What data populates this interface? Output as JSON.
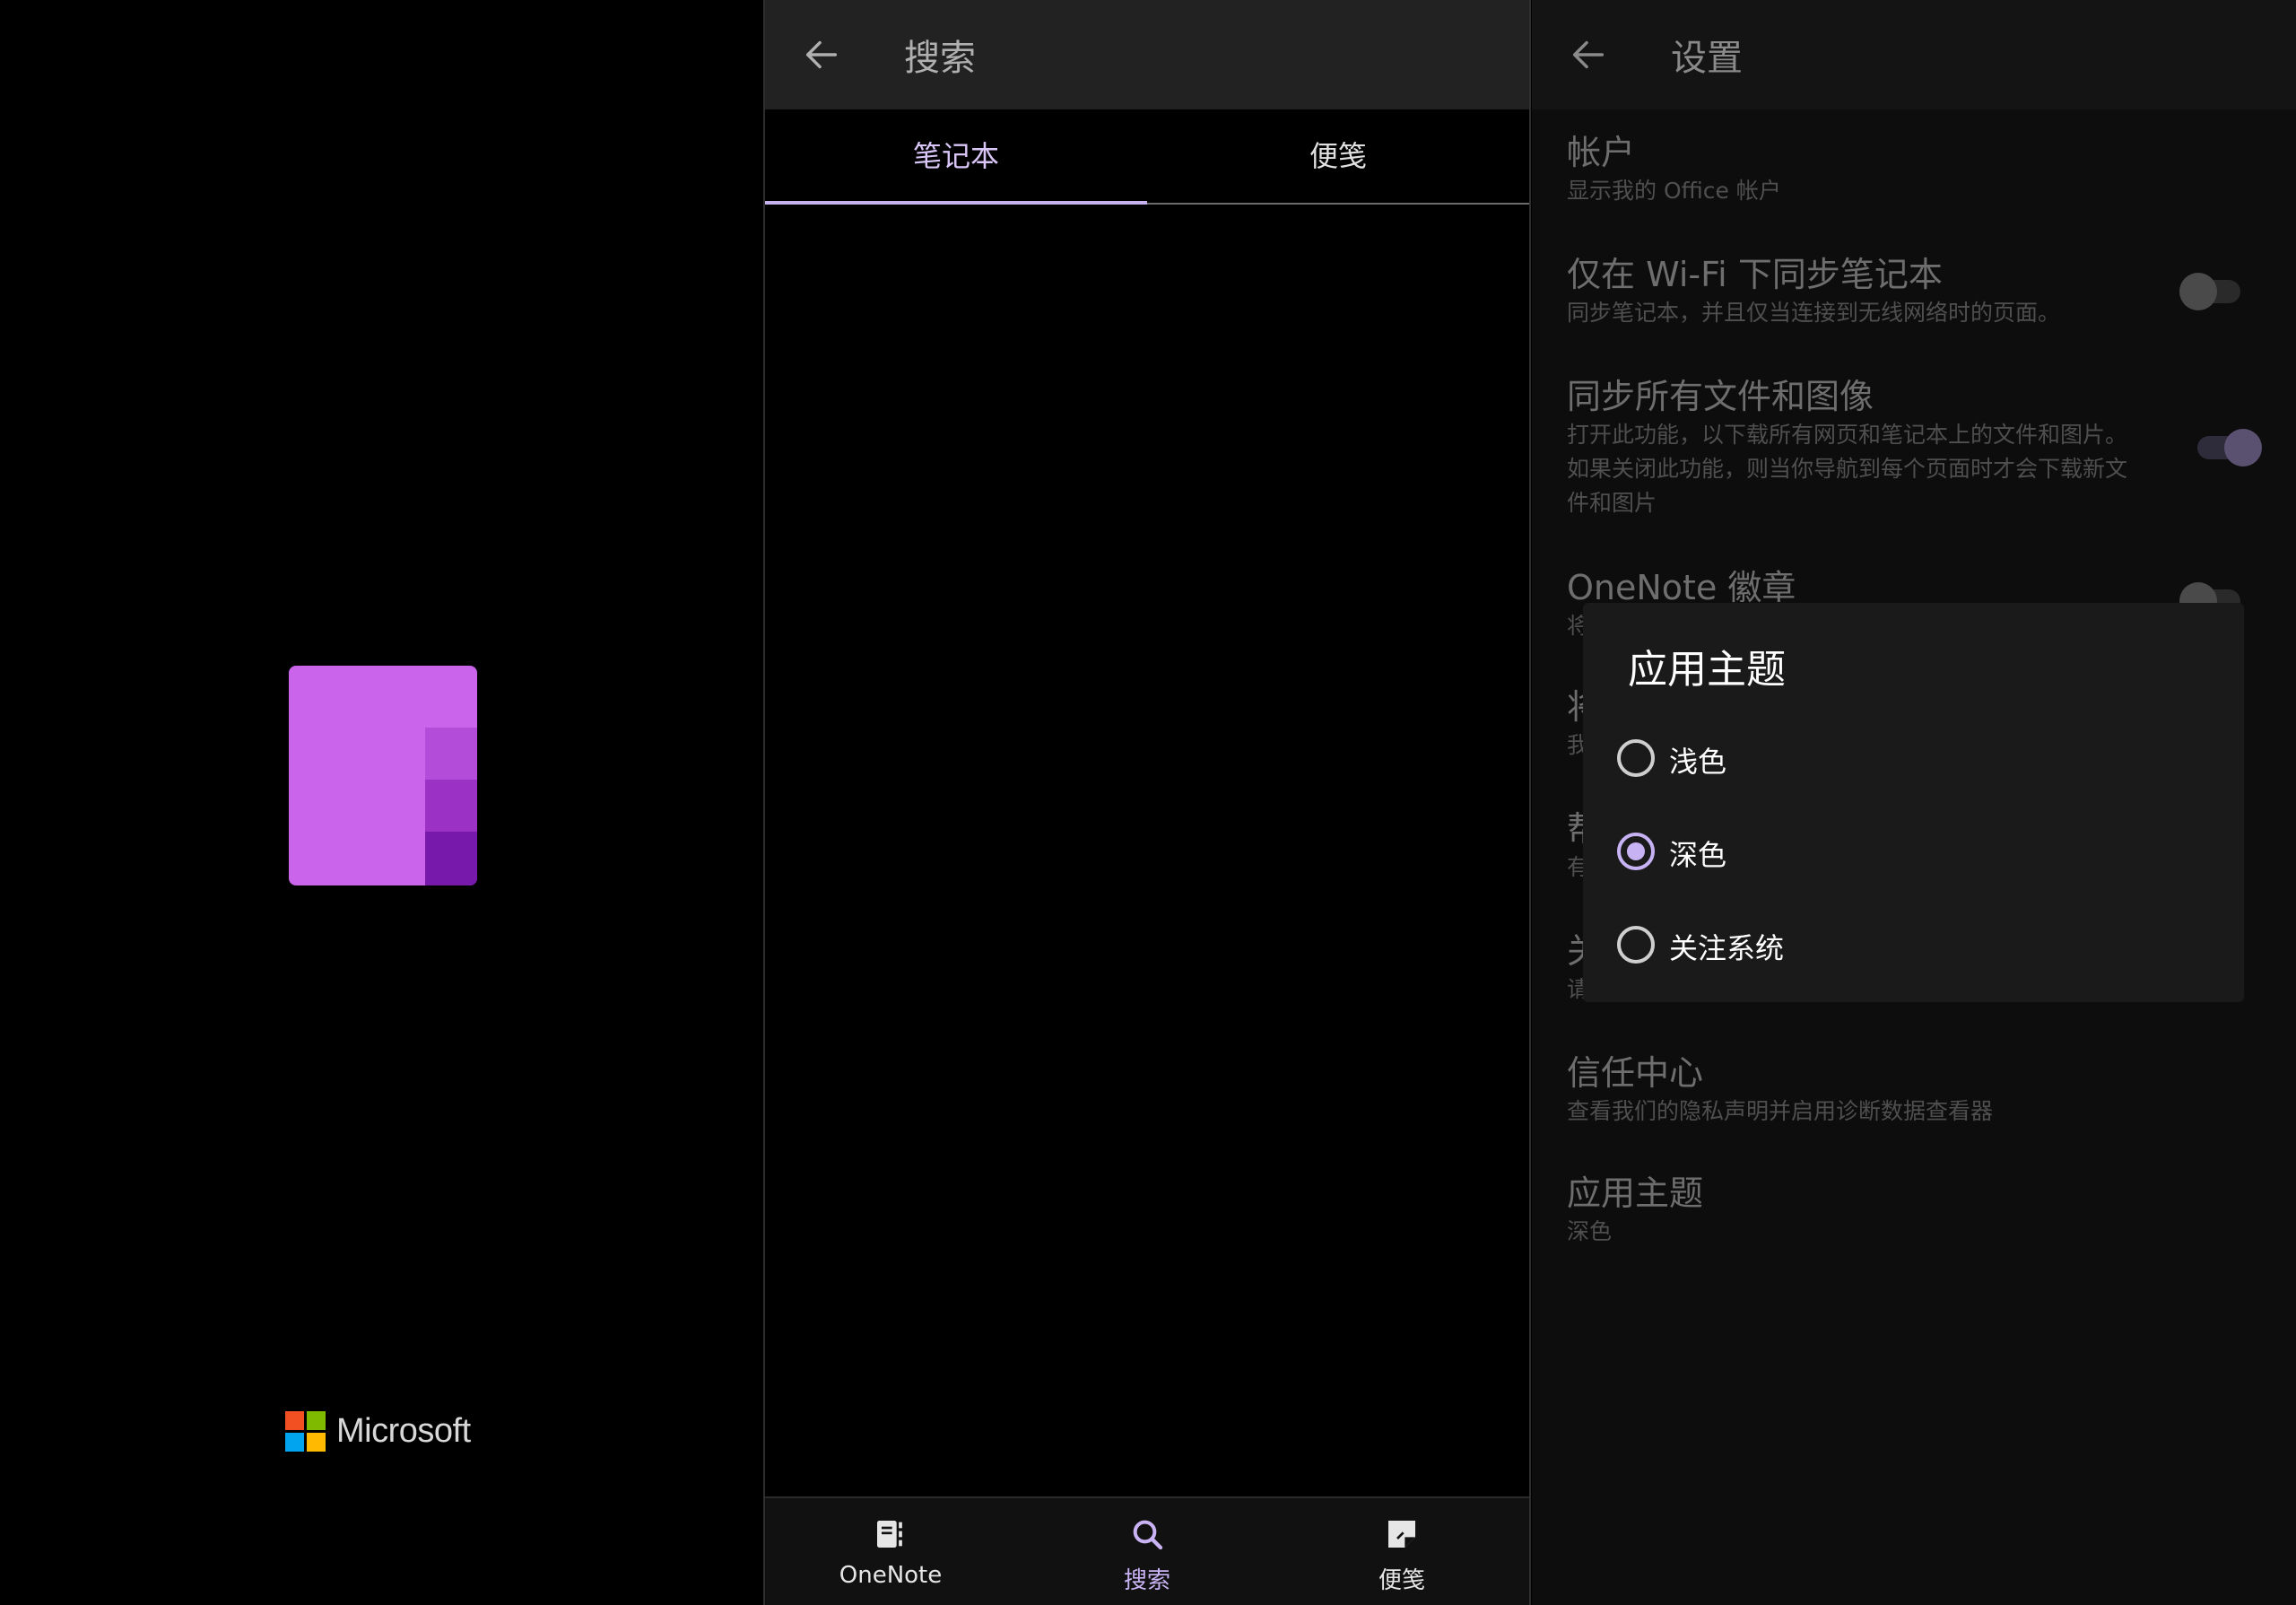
{
  "splash": {
    "brand_name": "Microsoft",
    "colors": {
      "tile": "#ca64ea",
      "shade1": "#b34cd8",
      "shade2": "#9b31c5",
      "shade3": "#7719aa",
      "ms_red": "#f25022",
      "ms_green": "#7fba00",
      "ms_blue": "#00a4ef",
      "ms_yellow": "#ffb900"
    }
  },
  "search": {
    "title": "搜索",
    "tabs": [
      {
        "label": "笔记本",
        "active": true
      },
      {
        "label": "便笺",
        "active": false
      }
    ],
    "bottom_nav": [
      {
        "label": "OneNote",
        "icon": "notebook-icon",
        "active": false
      },
      {
        "label": "搜索",
        "icon": "search-icon",
        "active": true
      },
      {
        "label": "便笺",
        "icon": "sticky-note-icon",
        "active": false
      }
    ],
    "accent": "#c7b2ef"
  },
  "settings": {
    "title": "设置",
    "items": [
      {
        "title": "帐户",
        "desc": "显示我的 Office 帐户"
      },
      {
        "title": "仅在 Wi-Fi 下同步笔记本",
        "desc": "同步笔记本，并且仅当连接到无线网络时的页面。",
        "toggle": "off"
      },
      {
        "title": "同步所有文件和图像",
        "desc": "打开此功能，以下载所有网页和笔记本上的文件和图片。如果关闭此功能，则当你导航到每个页面时才会下载新文件和图片",
        "toggle": "on"
      },
      {
        "title": "OneNote 徽章",
        "desc": "将",
        "toggle": "off"
      },
      {
        "title": "将",
        "desc": "我"
      },
      {
        "title": "帮",
        "desc": "有"
      },
      {
        "title": "关",
        "desc": "请"
      },
      {
        "title": "信任中心",
        "desc": "查看我们的隐私声明并启用诊断数据查看器"
      },
      {
        "title": "应用主题",
        "desc": "深色"
      }
    ],
    "dialog": {
      "title": "应用主题",
      "options": [
        {
          "label": "浅色",
          "selected": false
        },
        {
          "label": "深色",
          "selected": true
        },
        {
          "label": "关注系统",
          "selected": false
        }
      ]
    }
  }
}
